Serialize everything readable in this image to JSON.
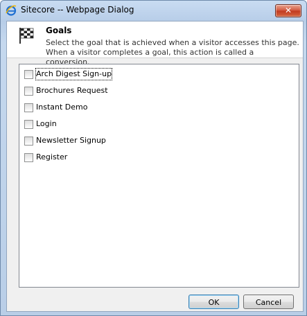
{
  "window": {
    "title": "Sitecore -- Webpage Dialog",
    "close_label": "✕",
    "icon": "ie-icon"
  },
  "header": {
    "title": "Goals",
    "description": "Select the goal that is achieved when a visitor accesses this page. When a visitor completes a goal, this action is called a conversion.",
    "icon": "checkered-flag-icon"
  },
  "goals": [
    {
      "label": "Arch Digest Sign-up",
      "checked": false,
      "focused": true
    },
    {
      "label": "Brochures Request",
      "checked": false,
      "focused": false
    },
    {
      "label": "Instant Demo",
      "checked": false,
      "focused": false
    },
    {
      "label": "Login",
      "checked": false,
      "focused": false
    },
    {
      "label": "Newsletter Signup",
      "checked": false,
      "focused": false
    },
    {
      "label": "Register",
      "checked": false,
      "focused": false
    }
  ],
  "buttons": {
    "ok_label": "OK",
    "cancel_label": "Cancel"
  }
}
